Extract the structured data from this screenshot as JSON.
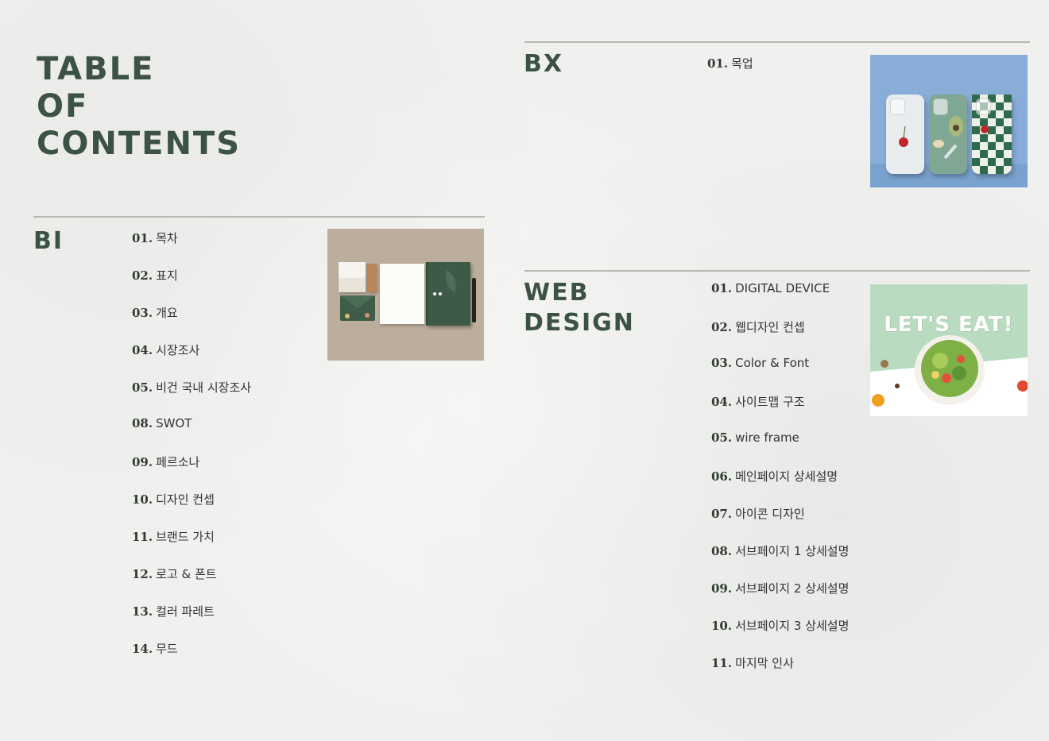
{
  "title_lines": [
    "TABLE",
    "OF",
    "CONTENTS"
  ],
  "bi": {
    "title": "BI",
    "items": [
      {
        "num": "01.",
        "label": "목차"
      },
      {
        "num": "02.",
        "label": "표지"
      },
      {
        "num": "03.",
        "label": "개요"
      },
      {
        "num": "04.",
        "label": "시장조사"
      },
      {
        "num": "05.",
        "label": "비건 국내 시장조사"
      },
      {
        "num": "08.",
        "label": "SWOT"
      },
      {
        "num": "09.",
        "label": "페르소나"
      },
      {
        "num": "10.",
        "label": "디자인 컨셉"
      },
      {
        "num": "11.",
        "label": "브랜드 가치"
      },
      {
        "num": "12.",
        "label": "로고 & 폰트"
      },
      {
        "num": "13.",
        "label": "컬러 파레트"
      },
      {
        "num": "14.",
        "label": "무드"
      }
    ]
  },
  "bx": {
    "title": "BX",
    "items": [
      {
        "num": "01.",
        "label": "목업"
      }
    ]
  },
  "web": {
    "title_lines": [
      "WEB",
      "DESIGN"
    ],
    "thumb_text": "LET'S EAT!",
    "items": [
      {
        "num": "01.",
        "label": "DIGITAL DEVICE"
      },
      {
        "num": "02.",
        "label": "웹디자인 컨셉"
      },
      {
        "num": "03.",
        "label": "Color & Font"
      },
      {
        "num": "04.",
        "label": "사이트맵 구조"
      },
      {
        "num": "05.",
        "label": "wire frame"
      },
      {
        "num": "06.",
        "label": "메인페이지 상세설명"
      },
      {
        "num": "07.",
        "label": "아이콘 디자인"
      },
      {
        "num": "08.",
        "label": "서브페이지 1 상세설명"
      },
      {
        "num": "09.",
        "label": "서브페이지 2 상세설명"
      },
      {
        "num": "10.",
        "label": "서브페이지 3 상세설명"
      },
      {
        "num": "11.",
        "label": "마지막 인사"
      }
    ]
  },
  "colors": {
    "accent_green": "#3b5244",
    "background": "#f0f0ee",
    "rule": "#b7b7b4"
  }
}
